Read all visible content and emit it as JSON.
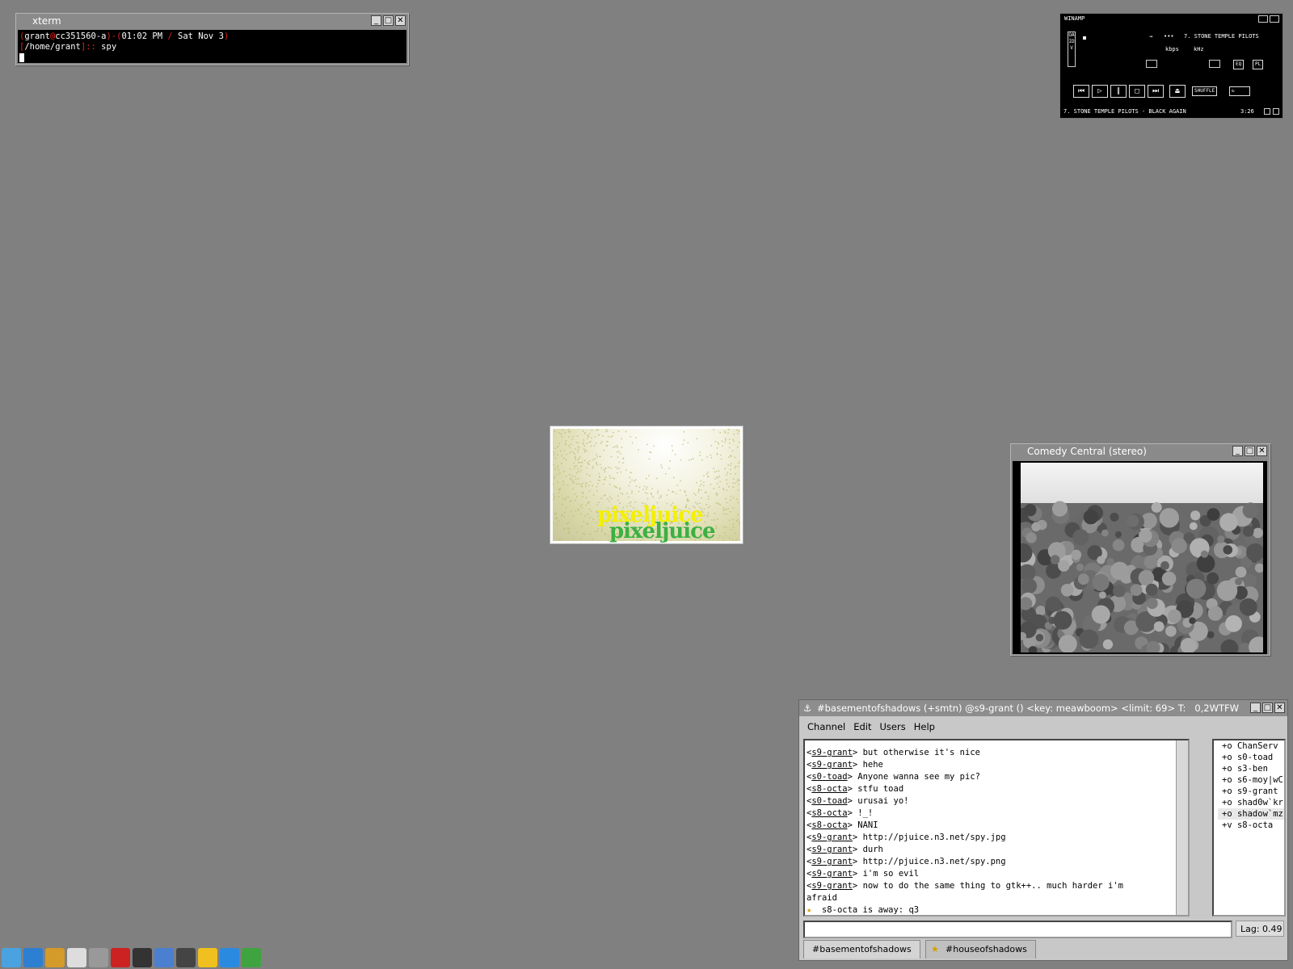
{
  "desktop": {
    "background": "#808080"
  },
  "xterm": {
    "title": "xterm",
    "line1": {
      "p1": "(",
      "user": "grant",
      "at": "@",
      "host": "cc351560-a",
      "p2": ")-(",
      "time": "01:02 PM",
      "slash": " / ",
      "date": "Sat Nov  3",
      "p3": ")"
    },
    "line2": {
      "b1": "[",
      "path": "/home/grant",
      "b2": "]",
      "sep": ":: ",
      "cmd": "spy"
    }
  },
  "winamp": {
    "title": "WINAMP",
    "sidebar": "OAIDV",
    "track_display": "7. STONE TEMPLE PILOTS",
    "kbps_label": "kbps",
    "khz_label": "kHz",
    "eq_label": "EQ",
    "pl_label": "PL",
    "shuffle_label": "SHUFFLE",
    "playlist_line": "7. STONE TEMPLE PILOTS - BLACK AGAIN",
    "playlist_time": "3:26"
  },
  "pixeljuice": {
    "word_top": "pixeljuice",
    "word_bottom": "pixeljuice"
  },
  "tv": {
    "title": "Comedy Central (stereo)"
  },
  "irc": {
    "title": "#basementofshadows (+smtn) @s9-grant () <key: meawboom> <limit: 69> T:",
    "title_right": "0,2WTFW",
    "menu": [
      "Channel",
      "Edit",
      "Users",
      "Help"
    ],
    "messages": [
      {
        "nick": "s9-grant",
        "text": "but otherwise it's nice"
      },
      {
        "nick": "s9-grant",
        "text": "hehe"
      },
      {
        "nick": "s0-toad",
        "text": "Anyone wanna see my pic?"
      },
      {
        "nick": "s8-octa",
        "text": "stfu toad"
      },
      {
        "nick": "s0-toad",
        "text": "urusai yo!"
      },
      {
        "nick": "s8-octa",
        "text": "!_!"
      },
      {
        "nick": "s8-octa",
        "text": "NANI"
      },
      {
        "nick": "s9-grant",
        "text": "http://pjuice.n3.net/spy.jpg"
      },
      {
        "nick": "s9-grant",
        "text": "durh"
      },
      {
        "nick": "s9-grant",
        "text": "http://pjuice.n3.net/spy.png"
      },
      {
        "nick": "s9-grant",
        "text": "i'm so evil"
      },
      {
        "nick": "s9-grant",
        "text": "now to do the same thing to gtk++.. much harder i'm"
      }
    ],
    "wrap_line": "afraid",
    "away_line": "s8-octa is away: q3",
    "users": [
      "+o ChanServ",
      "+o s0-toad",
      "+o s3-ben",
      "+o s6-moy|wC",
      "+o s9-grant",
      "+o shad0w`kr",
      "+o shadow`mz",
      "+v s8-octa"
    ],
    "lag": "Lag: 0.49",
    "tabs": [
      "#basementofshadows",
      "#houseofshadows"
    ]
  },
  "dock": {
    "icons": [
      "computer-icon",
      "globe-icon",
      "browser-icon",
      "mail-icon",
      "eye-icon",
      "book-icon",
      "terminal-icon",
      "users-icon",
      "linux-icon",
      "lightning-icon",
      "info-icon",
      "tool-icon"
    ],
    "colors": [
      "#4aa3e0",
      "#2d7fd1",
      "#d49a2a",
      "#dddddd",
      "#999999",
      "#cc2222",
      "#333333",
      "#4b7fd0",
      "#444444",
      "#f0c020",
      "#2a8ae0",
      "#3fa33f"
    ]
  }
}
